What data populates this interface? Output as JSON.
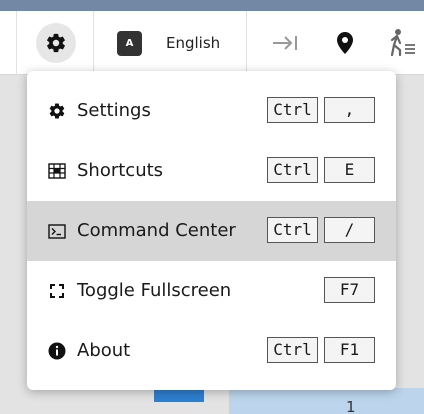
{
  "toolbar": {
    "settings_icon": "gear-icon",
    "language_badge": "A",
    "language_label": "English",
    "icons": [
      "arrow-to-right-icon",
      "map-pin-icon",
      "accessibility-walk-icon"
    ]
  },
  "background": {
    "cell_number": "1"
  },
  "menu": {
    "items": [
      {
        "label": "Settings",
        "icon": "gear-icon",
        "keys": [
          "Ctrl",
          ","
        ],
        "active": false
      },
      {
        "label": "Shortcuts",
        "icon": "keyboard-shortcuts-icon",
        "keys": [
          "Ctrl",
          "E"
        ],
        "active": false
      },
      {
        "label": "Command Center",
        "icon": "terminal-icon",
        "keys": [
          "Ctrl",
          "/"
        ],
        "active": true
      },
      {
        "label": "Toggle Fullscreen",
        "icon": "fullscreen-icon",
        "keys": [
          "F7"
        ],
        "active": false
      },
      {
        "label": "About",
        "icon": "info-icon",
        "keys": [
          "Ctrl",
          "F1"
        ],
        "active": false
      }
    ]
  },
  "colors": {
    "top_strip": "#7388a6",
    "active_item": "#d6d6d6",
    "accent_blue": "#2d7fd0"
  }
}
